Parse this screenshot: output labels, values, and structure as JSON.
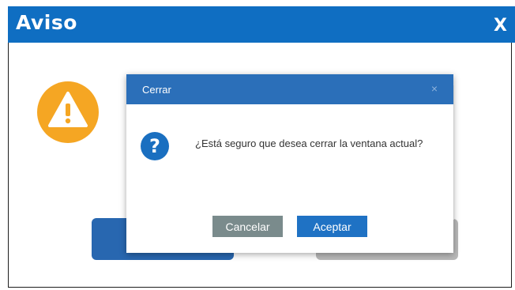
{
  "outer_window": {
    "title": "Aviso",
    "close_label": "X",
    "warning_icon": "warning-icon",
    "colors": {
      "header": "#0f6ec2",
      "warning": "#f5a623",
      "primary_button": "#2867b0",
      "secondary_button": "#b9b9b9"
    }
  },
  "dialog": {
    "title": "Cerrar",
    "close_label": "×",
    "icon": "question-icon",
    "message": "¿Está seguro que desea cerrar la ventana actual?",
    "cancel_label": "Cancelar",
    "accept_label": "Aceptar",
    "colors": {
      "header": "#2b6fb9",
      "icon": "#1a6fc0",
      "cancel": "#7a8b8c",
      "accept": "#1f72c4"
    }
  }
}
